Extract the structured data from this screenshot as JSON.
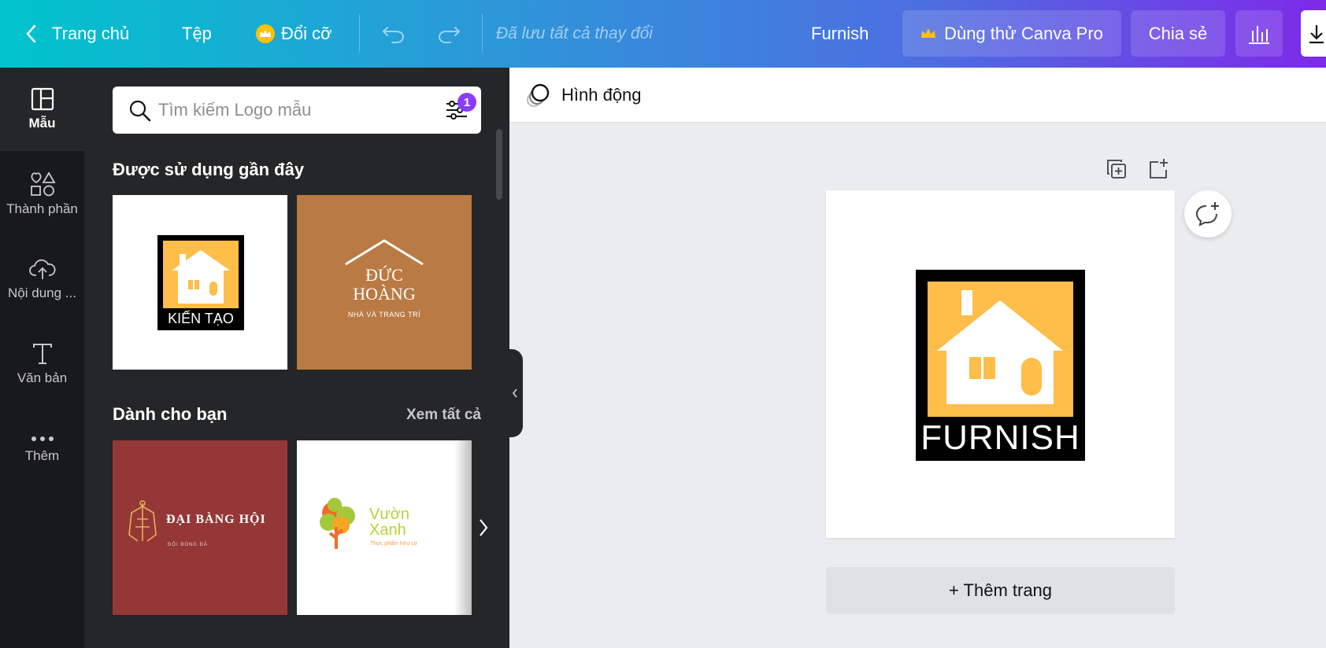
{
  "topbar": {
    "home_label": "Trang chủ",
    "file_label": "Tệp",
    "resize_label": "Đổi cỡ",
    "saved_status": "Đã lưu tất cả thay đổi",
    "design_name": "Furnish",
    "pro_trial_label": "Dùng thử Canva Pro",
    "share_label": "Chia sẻ"
  },
  "rail": {
    "items": [
      {
        "label": "Mẫu",
        "icon": "template-icon"
      },
      {
        "label": "Thành phần",
        "icon": "elements-icon"
      },
      {
        "label": "Nội dung ...",
        "icon": "upload-cloud-icon"
      },
      {
        "label": "Văn bản",
        "icon": "text-icon"
      },
      {
        "label": "Thêm",
        "icon": "more-icon"
      }
    ]
  },
  "panel": {
    "search_placeholder": "Tìm kiếm Logo mẫu",
    "filter_count": "1",
    "recent_title": "Được sử dụng gần đây",
    "for_you_title": "Dành cho bạn",
    "see_all_label": "Xem tất cả",
    "recent": [
      {
        "title": "KIẾN TẠO"
      },
      {
        "title_line1": "ĐỨC",
        "title_line2": "HOÀNG",
        "subtitle": "NHÀ VÀ TRANG TRÍ"
      }
    ],
    "for_you": [
      {
        "title": "ĐẠI BÀNG HỘI",
        "subtitle": "ĐỘI BÓNG ĐÁ"
      },
      {
        "title_line1": "Vườn",
        "title_line2": "Xanh",
        "subtitle": "Thực phẩm hữu cơ"
      }
    ]
  },
  "editor": {
    "animate_label": "Hình động",
    "logo_text": "FURNISH",
    "add_page_label": "+ Thêm trang"
  },
  "colors": {
    "accent_yellow": "#ffbd4a",
    "brown_bg": "#b97a43",
    "red_bg": "#963737",
    "pro_purple": "#8b3dff"
  }
}
